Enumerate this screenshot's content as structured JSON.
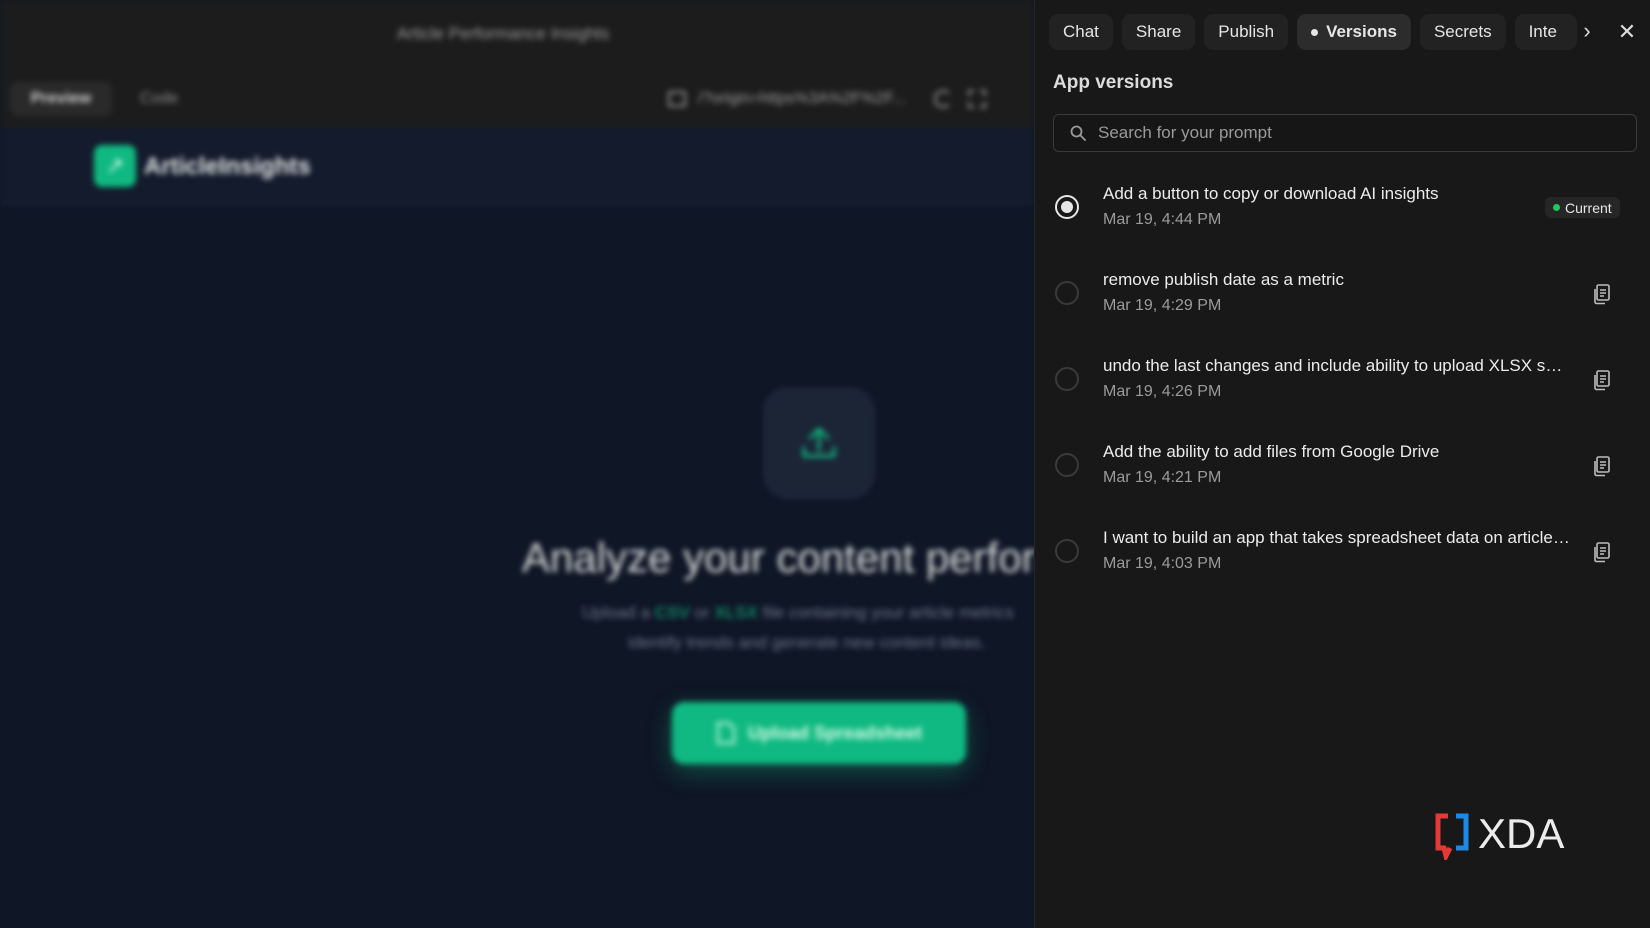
{
  "preview": {
    "title": "Article Performance Insights",
    "tab_preview": "Preview",
    "tab_code": "Code",
    "url": "/?origin=https%3A%2F%2F...",
    "app_name": "ArticleInsights",
    "hero_title": "Analyze your content perform",
    "hero_sub_prefix": "Upload a ",
    "hero_sub_csv": "CSV",
    "hero_sub_or": " or ",
    "hero_sub_xlsx": "XLSX",
    "hero_sub_suffix": " file containing your article metrics",
    "hero_sub_line2": "identify trends and generate new content ideas.",
    "upload_button": "Upload Spreadsheet"
  },
  "panel": {
    "tabs": [
      "Chat",
      "Share",
      "Publish",
      "Versions",
      "Secrets",
      "Inte"
    ],
    "heading": "App versions",
    "search_placeholder": "Search for your prompt",
    "current_label": "Current",
    "versions": [
      {
        "title": "Add a button to copy or download AI insights",
        "time": "Mar 19, 4:44 PM",
        "current": true
      },
      {
        "title": "remove publish date as a metric",
        "time": "Mar 19, 4:29 PM",
        "current": false
      },
      {
        "title": "undo the last changes and include ability to upload XLSX spr...",
        "time": "Mar 19, 4:26 PM",
        "current": false
      },
      {
        "title": "Add the ability to add files from Google Drive",
        "time": "Mar 19, 4:21 PM",
        "current": false
      },
      {
        "title": "I want to build an app that takes spreadsheet data on article ...",
        "time": "Mar 19, 4:03 PM",
        "current": false
      }
    ]
  },
  "watermark": {
    "text": "XDA"
  },
  "colors": {
    "accent": "#10b981",
    "current_dot": "#22c55e",
    "xda_red": "#e53935",
    "xda_blue": "#1e88e5"
  }
}
